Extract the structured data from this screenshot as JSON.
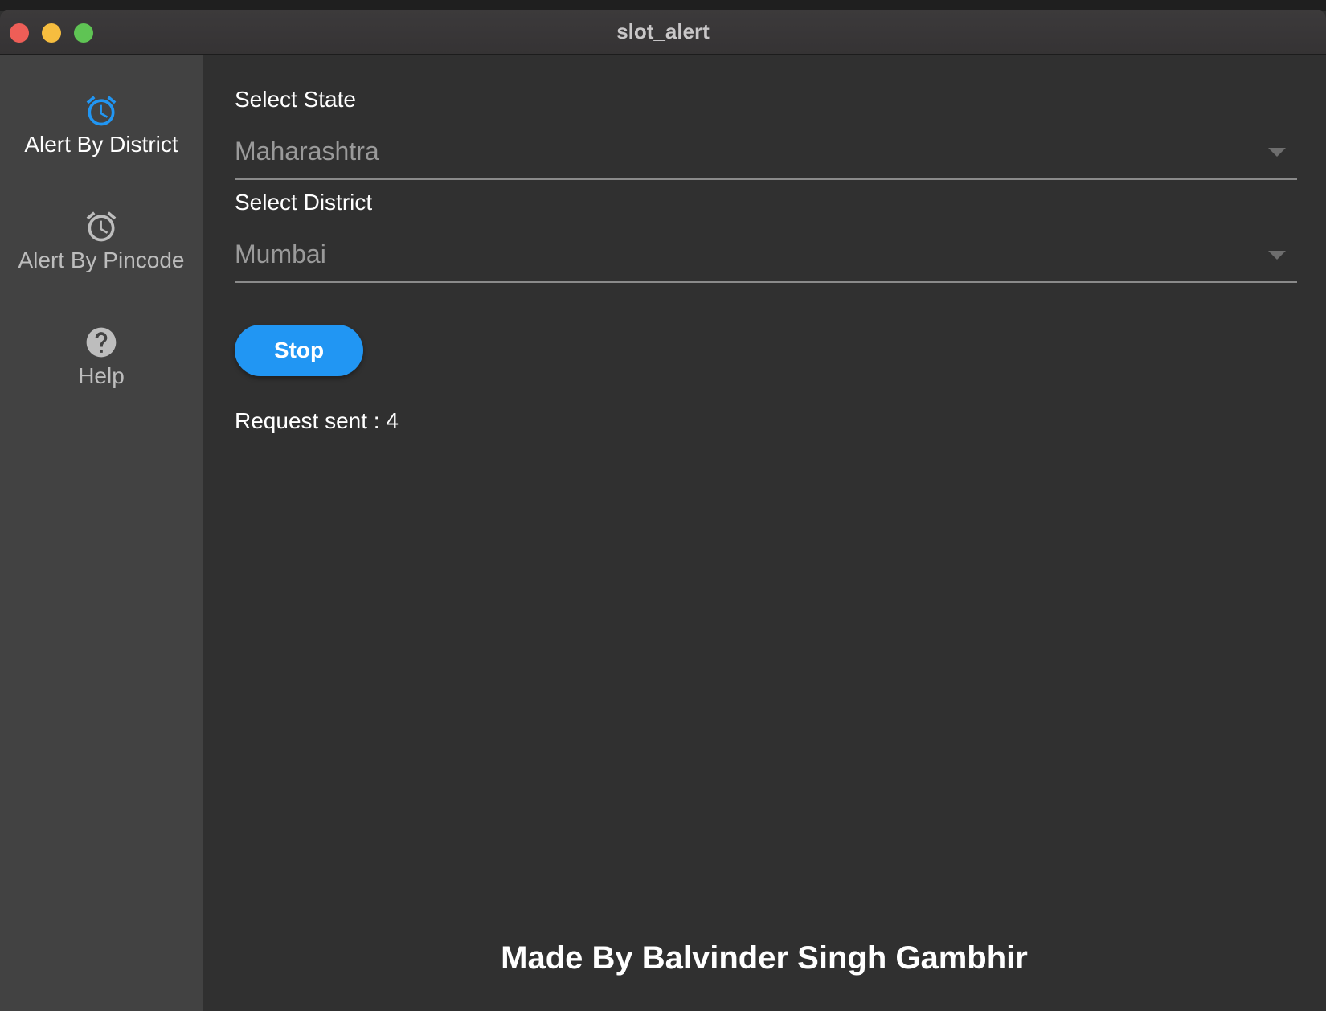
{
  "window": {
    "title": "slot_alert"
  },
  "sidebar": {
    "items": [
      {
        "label": "Alert By District",
        "icon": "alarm-clock-icon",
        "active": true,
        "color": "#2196f3"
      },
      {
        "label": "Alert By Pincode",
        "icon": "alarm-clock-icon",
        "active": false,
        "color": "#bdbdbd"
      },
      {
        "label": "Help",
        "icon": "help-circle-icon",
        "active": false,
        "color": "#bdbdbd"
      }
    ]
  },
  "form": {
    "state_label": "Select State",
    "state_value": "Maharashtra",
    "district_label": "Select District",
    "district_value": "Mumbai",
    "stop_label": "Stop",
    "status_text": "Request sent : 4"
  },
  "footer": {
    "credit": "Made By Balvinder Singh Gambhir"
  },
  "colors": {
    "accent": "#2196f3",
    "sidebar_bg": "#424242",
    "content_bg": "#303030"
  }
}
